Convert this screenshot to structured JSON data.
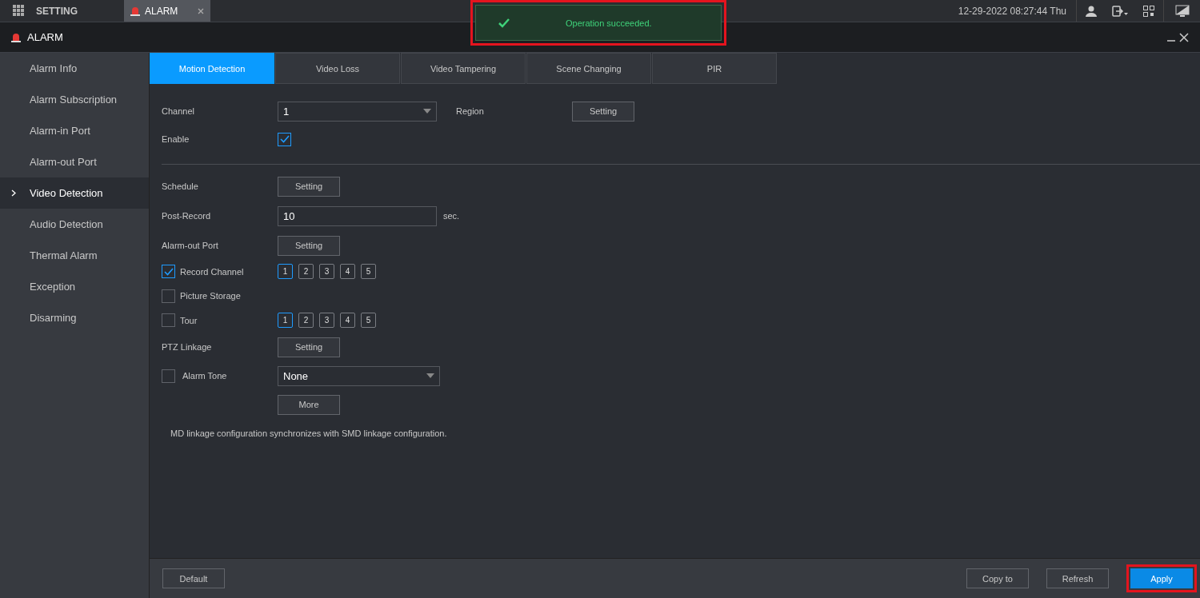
{
  "topbar": {
    "menu_label": "SETTING",
    "tab": {
      "label": "ALARM",
      "selected": true
    },
    "datetime": "12-29-2022 08:27:44 Thu"
  },
  "toast": {
    "message": "Operation succeeded.",
    "highlighted": true
  },
  "window": {
    "title": "ALARM"
  },
  "sidebar": {
    "items": [
      {
        "label": "Alarm Info",
        "selected": false
      },
      {
        "label": "Alarm Subscription",
        "selected": false
      },
      {
        "label": "Alarm-in Port",
        "selected": false
      },
      {
        "label": "Alarm-out Port",
        "selected": false
      },
      {
        "label": "Video Detection",
        "selected": true
      },
      {
        "label": "Audio Detection",
        "selected": false
      },
      {
        "label": "Thermal Alarm",
        "selected": false
      },
      {
        "label": "Exception",
        "selected": false
      },
      {
        "label": "Disarming",
        "selected": false
      }
    ]
  },
  "tabs": [
    {
      "label": "Motion Detection",
      "selected": true
    },
    {
      "label": "Video Loss",
      "selected": false
    },
    {
      "label": "Video Tampering",
      "selected": false
    },
    {
      "label": "Scene Changing",
      "selected": false
    },
    {
      "label": "PIR",
      "selected": false
    }
  ],
  "form": {
    "channel": {
      "label": "Channel",
      "value": "1"
    },
    "region": {
      "label": "Region",
      "button": "Setting"
    },
    "enable": {
      "label": "Enable",
      "checked": true
    },
    "schedule": {
      "label": "Schedule",
      "button": "Setting"
    },
    "post_record": {
      "label": "Post-Record",
      "value": "10",
      "unit": "sec."
    },
    "alarm_out": {
      "label": "Alarm-out Port",
      "button": "Setting"
    },
    "record_channel": {
      "label": "Record Channel",
      "checked": true,
      "channels": [
        {
          "label": "1",
          "selected": true
        },
        {
          "label": "2",
          "selected": false
        },
        {
          "label": "3",
          "selected": false
        },
        {
          "label": "4",
          "selected": false
        },
        {
          "label": "5",
          "selected": false
        }
      ]
    },
    "picture_storage": {
      "label": "Picture Storage",
      "checked": false
    },
    "tour": {
      "label": "Tour",
      "checked": false,
      "channels": [
        {
          "label": "1",
          "selected": true
        },
        {
          "label": "2",
          "selected": false
        },
        {
          "label": "3",
          "selected": false
        },
        {
          "label": "4",
          "selected": false
        },
        {
          "label": "5",
          "selected": false
        }
      ]
    },
    "ptz": {
      "label": "PTZ Linkage",
      "button": "Setting"
    },
    "alarm_tone": {
      "label": "Alarm Tone",
      "checked": false,
      "value": "None"
    },
    "more": "More",
    "note": "MD linkage configuration synchronizes with SMD linkage configuration."
  },
  "footer": {
    "default": "Default",
    "copy_to": "Copy to",
    "refresh": "Refresh",
    "apply": {
      "label": "Apply",
      "highlighted": true
    }
  }
}
